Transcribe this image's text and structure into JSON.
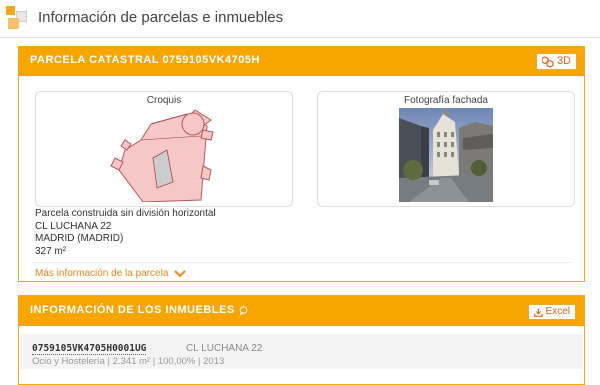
{
  "header": {
    "title": "Información de parcelas e inmuebles",
    "logo_icon": "catastro-logo-icon"
  },
  "parcel": {
    "title": "PARCELA CATASTRAL 0759105VK4705H",
    "btn_3d": "3D",
    "croquis_label": "Croquis",
    "photo_label": "Fotografía fachada",
    "description": "Parcela construida sin división horizontal",
    "street": "CL LUCHANA 22",
    "city": "MADRID (MADRID)",
    "area": "327 m²",
    "more_info": "Más información de la parcela"
  },
  "buildings": {
    "title": "INFORMACIÓN DE LOS INMUEBLES",
    "excel_label": "Excel",
    "items": [
      {
        "ref": "0759105VK4705H0001UG",
        "street": "CL LUCHANA 22",
        "meta": "Ocio y Hostelería | 2.341 m² | 100,00% | 2013"
      }
    ]
  },
  "colors": {
    "accent": "#f7a600",
    "link": "#e6891f",
    "button_text": "#d9631c"
  }
}
